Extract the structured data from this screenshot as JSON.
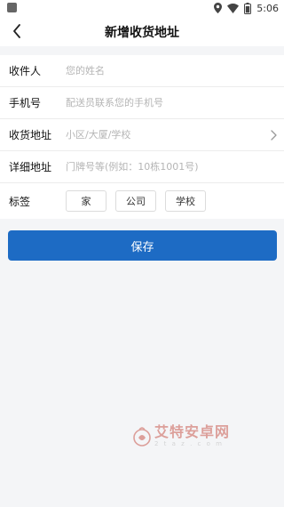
{
  "status_bar": {
    "time": "5:06"
  },
  "nav": {
    "title": "新增收货地址"
  },
  "form": {
    "receiver": {
      "label": "收件人",
      "placeholder": "您的姓名"
    },
    "phone": {
      "label": "手机号",
      "placeholder": "配送员联系您的手机号"
    },
    "region": {
      "label": "收货地址",
      "placeholder": "小区/大厦/学校"
    },
    "detail": {
      "label": "详细地址",
      "placeholder": "门牌号等(例如：10栋1001号)"
    },
    "tags": {
      "label": "标签",
      "options": [
        "家",
        "公司",
        "学校"
      ]
    }
  },
  "save_label": "保存",
  "watermark": {
    "name": "艾特安卓网",
    "sub": "2 t a z . c o m"
  },
  "colors": {
    "primary": "#1d6bc4",
    "background": "#f4f5f7"
  }
}
